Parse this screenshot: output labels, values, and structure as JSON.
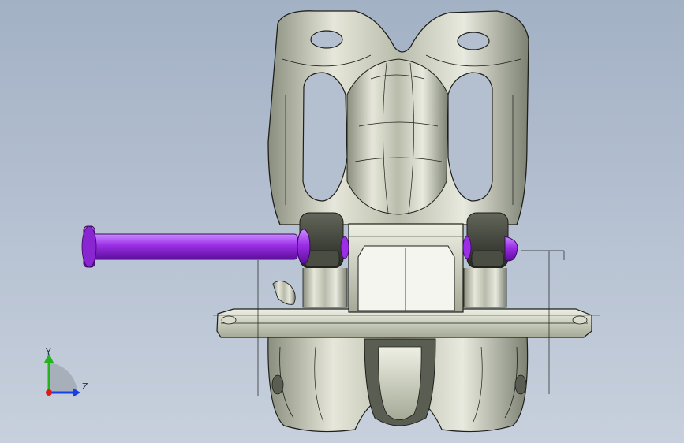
{
  "viewport": {
    "background_top": "#a3b1c5",
    "background_bottom": "#c7d0dc"
  },
  "model": {
    "body_color": "#cfd0c0",
    "body_shadow": "#6f7466",
    "edge_color": "#1e1f1a",
    "pin_color": "#9b2ee6",
    "pin_highlight": "#c98bff",
    "dark_rubber": "#3a3c34"
  },
  "triad": {
    "x_axis_color": "#e01818",
    "y_axis_color": "#22b41a",
    "z_axis_color": "#1a3fe0",
    "y_label": "Y",
    "z_label": "Z"
  }
}
